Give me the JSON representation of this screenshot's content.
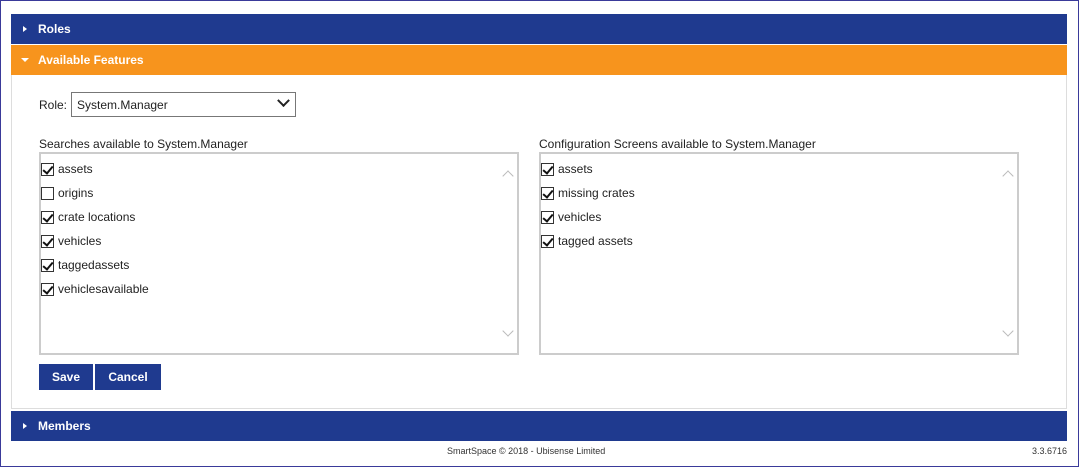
{
  "panels": {
    "roles": {
      "label": "Roles"
    },
    "features": {
      "label": "Available Features"
    },
    "members": {
      "label": "Members"
    }
  },
  "role": {
    "label": "Role:",
    "selected": "System.Manager"
  },
  "searches": {
    "title": "Searches available to System.Manager",
    "items": [
      {
        "label": "assets",
        "checked": true
      },
      {
        "label": "origins",
        "checked": false
      },
      {
        "label": "crate locations",
        "checked": true
      },
      {
        "label": "vehicles",
        "checked": true
      },
      {
        "label": "taggedassets",
        "checked": true
      },
      {
        "label": "vehiclesavailable",
        "checked": true
      }
    ]
  },
  "config": {
    "title": "Configuration Screens available to System.Manager",
    "items": [
      {
        "label": "assets",
        "checked": true
      },
      {
        "label": "missing crates",
        "checked": true
      },
      {
        "label": "vehicles",
        "checked": true
      },
      {
        "label": "tagged assets",
        "checked": true
      }
    ]
  },
  "buttons": {
    "save": "Save",
    "cancel": "Cancel"
  },
  "footer": {
    "copyright": "SmartSpace © 2018 - Ubisense Limited",
    "version": "3.3.6716"
  },
  "colors": {
    "header_blue": "#1f3a8f",
    "header_orange": "#f7941d"
  }
}
